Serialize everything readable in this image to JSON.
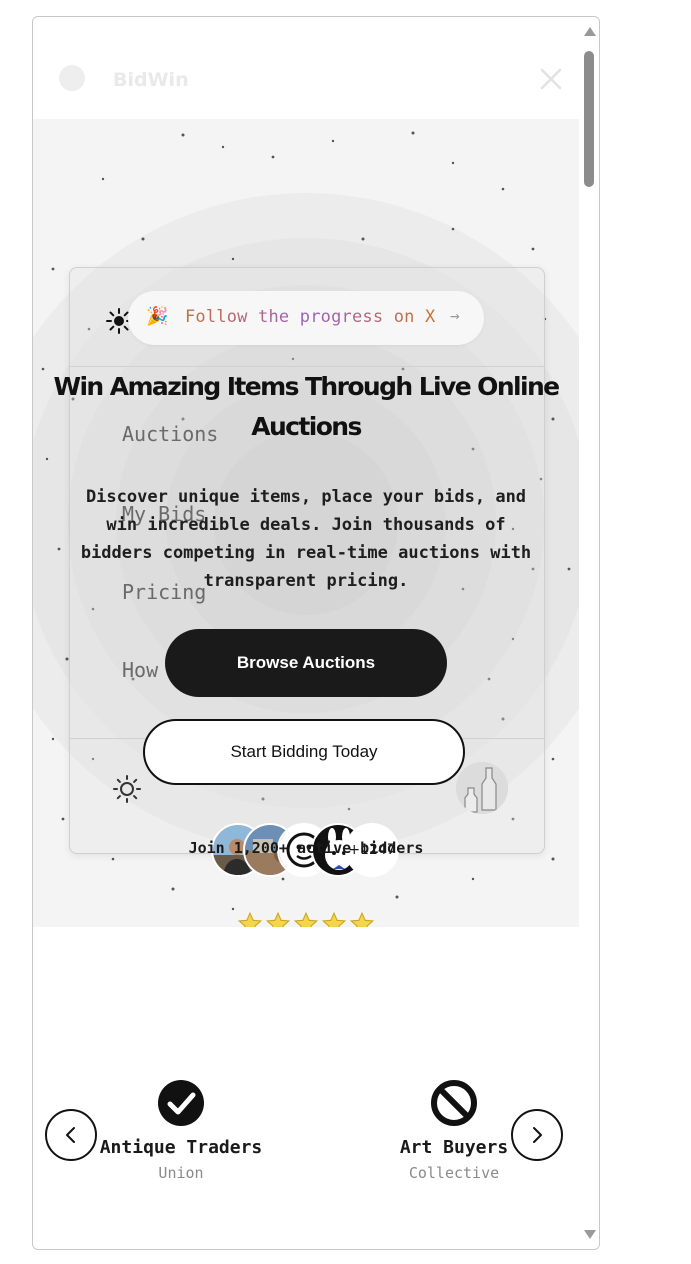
{
  "header": {
    "brand": "BidWin",
    "logo_icon": "logo-dot-icon",
    "close_icon": "close-icon"
  },
  "menu": {
    "items": [
      "Auctions",
      "My Bids",
      "Pricing",
      "How"
    ],
    "theme_icon_top": "sun-icon",
    "theme_icon_bottom": "sun-outline-icon"
  },
  "hero": {
    "announcement_emoji": "🎉",
    "announcement_text": "Follow the progress on X",
    "announcement_arrow": "→",
    "title": "Win Amazing Items Through Live Online Auctions",
    "subtitle": "Discover unique items, place your bids, and win incredible deals. Join thousands of bidders competing in real-time auctions with transparent pricing.",
    "primary_cta": "Browse Auctions",
    "secondary_cta": "Start Bidding Today",
    "avatar_overflow": "+1247",
    "rating_stars": 5,
    "social_proof": "Join 1,200+ active bidders"
  },
  "partners": {
    "prev_icon": "chevron-left-icon",
    "next_icon": "chevron-right-icon",
    "items": [
      {
        "name": "Antique Traders",
        "sub": "Union",
        "icon": "check-circle-icon"
      },
      {
        "name": "Art Buyers",
        "sub": "Collective",
        "icon": "prohibited-icon"
      }
    ]
  },
  "colors": {
    "primary": "#1a1a1a",
    "star": "#f5d64a",
    "announcement_gradient": [
      "#c2703d",
      "#9b5fc0",
      "#c9732e"
    ]
  }
}
